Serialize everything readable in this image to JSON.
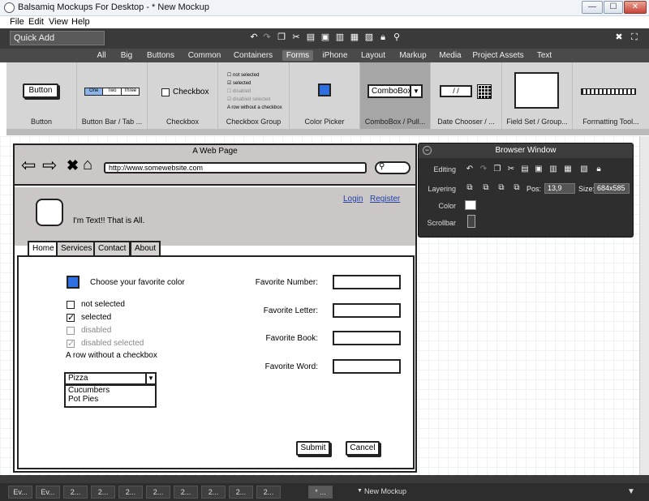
{
  "window": {
    "title": "Balsamiq Mockups For Desktop - * New Mockup",
    "min": "—",
    "max": "☐",
    "close": "✕"
  },
  "menu": [
    "File",
    "Edit",
    "View",
    "Help"
  ],
  "toolbar": {
    "quick_add": "Quick Add",
    "icons": [
      "undo-icon",
      "redo-icon",
      "copy-icon",
      "cut-icon",
      "paste-icon",
      "duplicate-icon",
      "delete-icon",
      "group-icon",
      "ungroup-icon",
      "lock-icon",
      "search-icon"
    ]
  },
  "categories": [
    "All",
    "Big",
    "Buttons",
    "Common",
    "Containers",
    "Forms",
    "iPhone",
    "Layout",
    "Markup",
    "Media",
    "Project Assets",
    "Text"
  ],
  "active_category": "Forms",
  "components": [
    {
      "label": "Button",
      "preview": "Button"
    },
    {
      "label": "Button Bar / Tab ...",
      "preview": [
        "One",
        "Two",
        "Three"
      ]
    },
    {
      "label": "Checkbox",
      "preview": "Checkbox"
    },
    {
      "label": "Checkbox Group",
      "preview": [
        "not selected",
        "selected",
        "disabled",
        "disabled selected",
        "A row without a checkbox"
      ]
    },
    {
      "label": "Color Picker",
      "preview": ""
    },
    {
      "label": "ComboBox / Pull...",
      "preview": "ComboBox"
    },
    {
      "label": "Date Chooser / ...",
      "preview": "/  /"
    },
    {
      "label": "Field Set / Group...",
      "preview": ""
    },
    {
      "label": "Formatting Tool...",
      "preview": ""
    }
  ],
  "mockup": {
    "page_title": "A Web Page",
    "url": "http://www.somewebsite.com",
    "login": "Login",
    "register": "Register",
    "text": "I'm Text!!  That is All.",
    "tabs": [
      "Home",
      "Services",
      "Contact",
      "About"
    ],
    "color_label": "Choose your favorite color",
    "color": "#2f6fe0",
    "checks": [
      {
        "label": "not selected",
        "state": "unchecked"
      },
      {
        "label": "selected",
        "state": "checked"
      },
      {
        "label": "disabled",
        "state": "disabled"
      },
      {
        "label": "disabled selected",
        "state": "disabled-checked"
      }
    ],
    "row_no_checkbox": "A row without a checkbox",
    "combo_value": "Pizza",
    "combo_options": [
      "Cucumbers",
      "Pot Pies"
    ],
    "fields": [
      "Favorite Number:",
      "Favorite Letter:",
      "Favorite Book:",
      "Favorite Word:"
    ],
    "submit": "Submit",
    "cancel": "Cancel"
  },
  "inspector": {
    "title": "Browser Window",
    "editing": "Editing",
    "layering": "Layering",
    "color": "Color",
    "scrollbar": "Scrollbar",
    "pos_label": "Pos:",
    "pos": "13,9",
    "size_label": "Size:",
    "size": "684x585"
  },
  "taskbar": {
    "items": [
      "Ev...",
      "Ev...",
      "2...",
      "2...",
      "2...",
      "2...",
      "2...",
      "2...",
      "2...",
      "2...",
      "* ..."
    ],
    "current": "New Mockup"
  }
}
